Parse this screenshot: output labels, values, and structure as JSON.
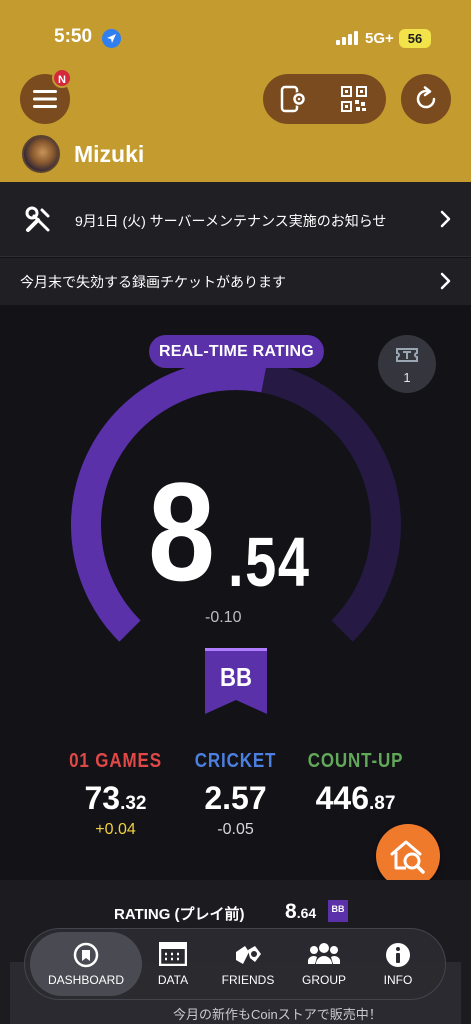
{
  "status_bar": {
    "time": "5:50",
    "network": "5G+",
    "battery": "56"
  },
  "header": {
    "menu_badge": "N",
    "user_name": "Mizuki",
    "icons": [
      "menu-icon",
      "settings-phone-icon",
      "qr-code-icon",
      "refresh-icon"
    ]
  },
  "notices": [
    {
      "text": "9月1日 (火) サーバーメンテナンス実施のお知らせ",
      "icon": "wrench-icon"
    },
    {
      "text": "今月末で失効する録画チケットがあります"
    }
  ],
  "rating": {
    "badge": "REAL-TIME RATING",
    "ticket_count": "1",
    "integer": "8",
    "decimal": ".54",
    "delta": "-0.10",
    "rank": "BB",
    "gauge_fill_fraction": 0.54,
    "gauge_color": "#5a31a8",
    "gauge_track_color": "#261a45"
  },
  "stats": {
    "games": {
      "label": "01 GAMES",
      "int": "73",
      "dec": ".32",
      "delta": "+0.04",
      "color": "#e04848"
    },
    "cricket": {
      "label": "CRICKET",
      "int": "2.57",
      "dec": "",
      "delta": "-0.05",
      "color": "#4c7fe0"
    },
    "countup": {
      "label": "COUNT-UP",
      "int": "446",
      "dec": ".87",
      "delta": "",
      "color": "#62a85a"
    }
  },
  "prev_rating": {
    "label": "RATING (プレイ前)",
    "int": "8",
    "dec": ".64",
    "rank": "BB"
  },
  "banner": {
    "text": "今月の新作もCoinストアで販売中！"
  },
  "nav": {
    "dashboard": "DASHBOARD",
    "data": "DATA",
    "friends": "FRIENDS",
    "group": "GROUP",
    "info": "INFO"
  },
  "colors": {
    "header": "#c39b2e",
    "accent_purple": "#5a31a8",
    "fab_orange": "#f07a2c",
    "dark_bg": "#121217"
  }
}
